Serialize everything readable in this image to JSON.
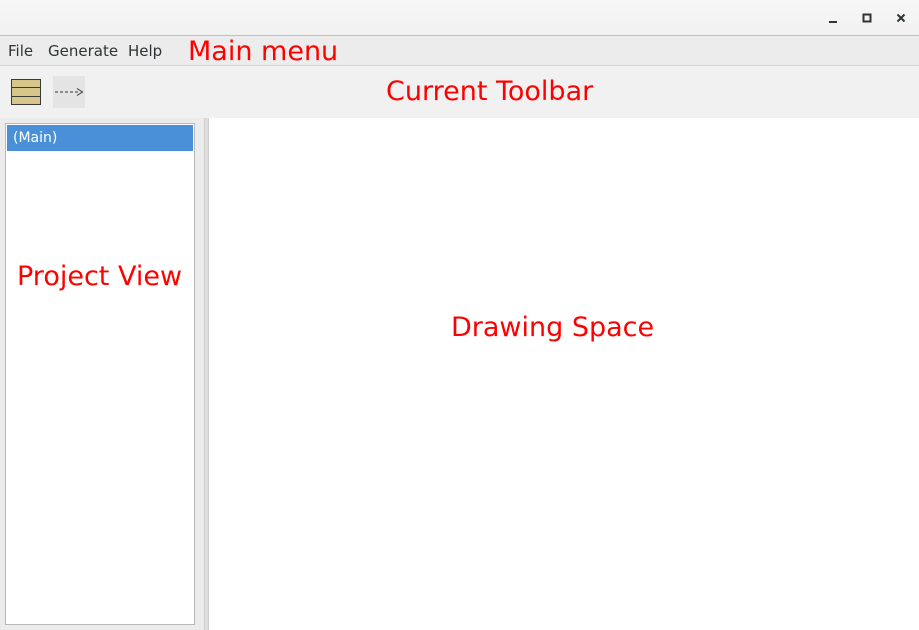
{
  "titlebar": {
    "buttons": {
      "minimize": "minimize-icon",
      "maximize": "maximize-icon",
      "close": "close-icon"
    }
  },
  "menu": {
    "items": [
      "File",
      "Generate",
      "Help"
    ]
  },
  "toolbar": {
    "tools": [
      {
        "name": "rectangle-tool",
        "icon": "striped-rectangle-icon",
        "fill": "#d6c68a"
      },
      {
        "name": "dashed-arrow-tool",
        "icon": "dashed-arrow-icon"
      }
    ]
  },
  "project_view": {
    "items": [
      {
        "label": "(Main)",
        "selected": true
      }
    ]
  },
  "annotations": {
    "main_menu": "Main menu",
    "current_toolbar": "Current Toolbar",
    "project_view": "Project View",
    "drawing_space": "Drawing Space"
  },
  "colors": {
    "selection": "#4a90d9",
    "annotation": "#ff0000"
  }
}
